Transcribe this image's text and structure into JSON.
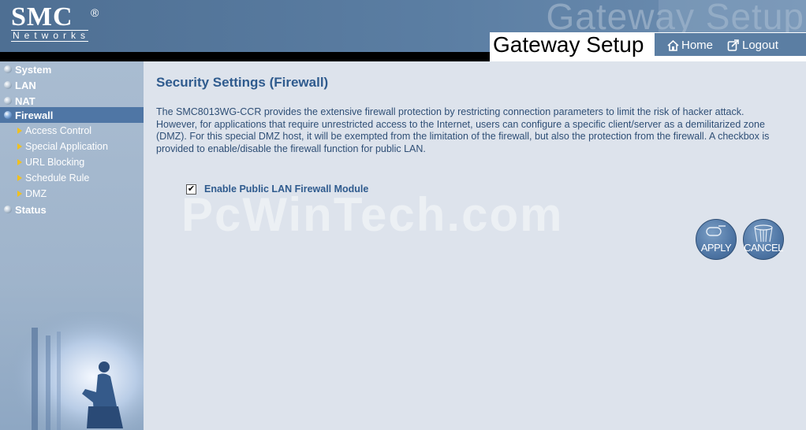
{
  "header": {
    "brand": "SMC",
    "brand_reg": "®",
    "brand_sub": "Networks",
    "watermark_title": "Gateway Setup",
    "title": "Gateway Setup",
    "home_label": "Home",
    "logout_label": "Logout"
  },
  "sidebar": {
    "items": [
      {
        "label": "System"
      },
      {
        "label": "LAN"
      },
      {
        "label": "NAT"
      },
      {
        "label": "Firewall"
      },
      {
        "label": "Status"
      }
    ],
    "subitems": [
      {
        "label": "Access Control"
      },
      {
        "label": "Special Application"
      },
      {
        "label": "URL Blocking"
      },
      {
        "label": "Schedule Rule"
      },
      {
        "label": "DMZ"
      }
    ]
  },
  "main": {
    "title": "Security Settings (Firewall)",
    "description": "The SMC8013WG-CCR provides the extensive firewall protection by restricting connection parameters to limit the risk of hacker attack. However, for applications that require unrestricted access to the Internet, users can configure a specific client/server as a demilitarized zone (DMZ). For this special DMZ host, it will be exempted from the limitation of the firewall, but also the protection from the firewall. A checkbox is provided to enable/disable the firewall function for public LAN.",
    "checkbox_label": "Enable Public LAN Firewall Module",
    "checkbox_checked": true,
    "checkbox_mark": "✔",
    "watermark": "PcWinTech.com",
    "apply_label": "APPLY",
    "cancel_label": "CANCEL"
  },
  "colors": {
    "accent": "#2f5b8e",
    "active_menu": "#4f76a5",
    "header": "#5b7ea3"
  }
}
